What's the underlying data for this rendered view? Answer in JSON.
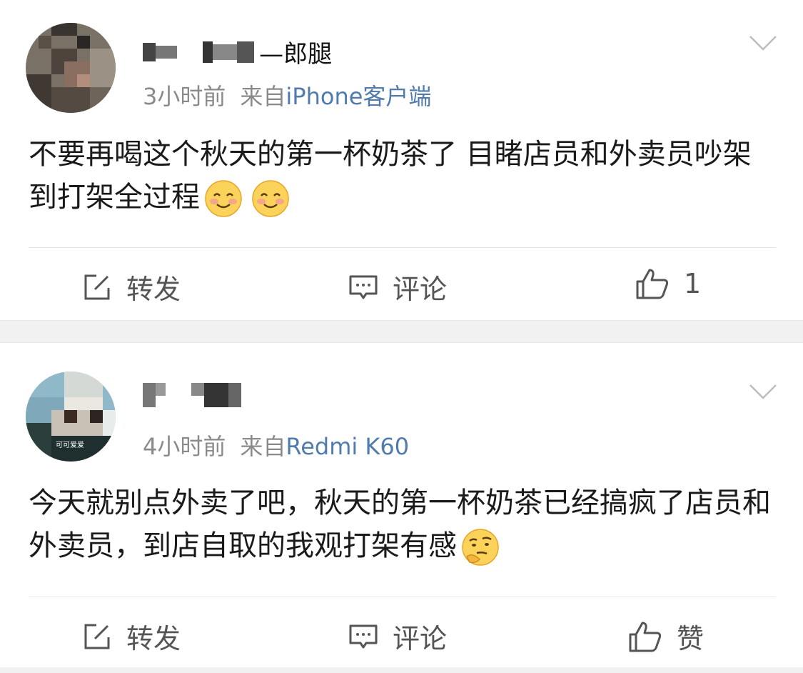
{
  "posts": [
    {
      "username_blurred": "██ ███ —郎腿",
      "time": "3小时前",
      "via": "来自",
      "source": "iPhone客户端",
      "text": "不要再喝这个秋天的第一杯奶茶了 目睹店员和外卖员吵架到打架全过程",
      "emojis": [
        "smile-emoji",
        "smile-emoji"
      ],
      "actions": {
        "repost": "转发",
        "comment": "评论",
        "like": "1"
      }
    },
    {
      "username_blurred": "█ ███",
      "time": "4小时前",
      "via": "来自",
      "source": "Redmi K60",
      "avatar_caption": "可可爱爱",
      "text": "今天就别点外卖了吧，秋天的第一杯奶茶已经搞疯了店员和外卖员，到店自取的我观打架有感",
      "emojis": [
        "thinking-emoji"
      ],
      "actions": {
        "repost": "转发",
        "comment": "评论",
        "like": "赞"
      }
    }
  ],
  "colors": {
    "source_link": "#4f7cad",
    "meta": "#8a8a8a",
    "separator": "#f1f1f1"
  }
}
